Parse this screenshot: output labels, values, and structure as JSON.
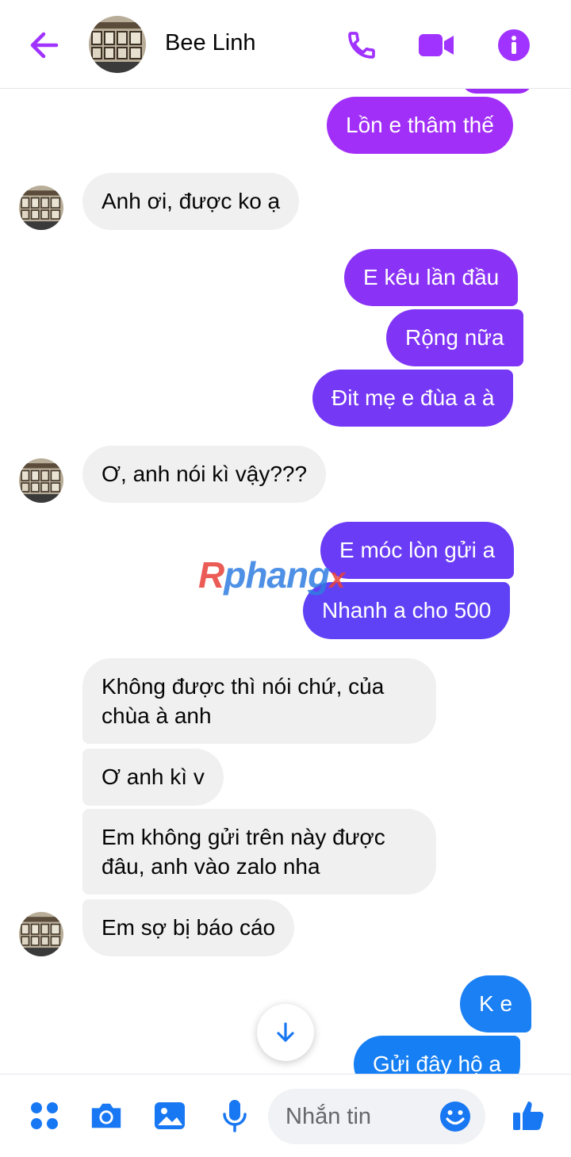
{
  "header": {
    "contact_name": "Bee Linh",
    "icons": [
      "arrow-left-icon",
      "phone-icon",
      "video-camera-icon",
      "info-icon"
    ]
  },
  "messages": [
    {
      "from": "me",
      "text": "Lồn e thâm thế"
    },
    {
      "from": "them",
      "text": "Anh ơi, được ko ạ"
    },
    {
      "from": "me",
      "text": "E kêu lần đầu"
    },
    {
      "from": "me",
      "text": "Rộng nữa"
    },
    {
      "from": "me",
      "text": "Đit mẹ e đùa a à"
    },
    {
      "from": "them",
      "text": "Ơ, anh nói kì vậy???"
    },
    {
      "from": "me",
      "text": "E móc lòn gửi a"
    },
    {
      "from": "me",
      "text": "Nhanh a cho 500"
    },
    {
      "from": "them",
      "text": "Không được thì nói chứ, của chùa à anh"
    },
    {
      "from": "them",
      "text": "Ơ anh kì v"
    },
    {
      "from": "them",
      "text": "Em không gửi trên này được đâu, anh vào zalo nha"
    },
    {
      "from": "them",
      "text": "Em sợ bị báo cáo"
    },
    {
      "from": "me",
      "text": "K e"
    },
    {
      "from": "me",
      "text": "Gửi đây hộ a"
    }
  ],
  "watermark": {
    "part1": "R",
    "part2": "phang",
    "part3": "x"
  },
  "composer": {
    "placeholder": "Nhắn tin",
    "icons": [
      "apps-grid-icon",
      "camera-icon",
      "image-icon",
      "microphone-icon",
      "emoji-icon",
      "thumbs-up-icon"
    ]
  },
  "colors": {
    "accent": "#a033ff",
    "bubble_purple": "#9b2cf6",
    "bubble_violet": "#6a3cf5",
    "bubble_blue": "#1d7bf0",
    "incoming_bubble": "#f0f0f0"
  }
}
